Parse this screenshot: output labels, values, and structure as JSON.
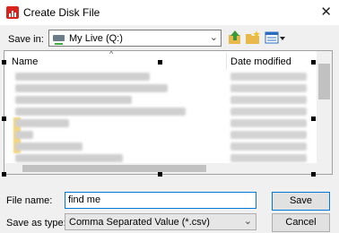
{
  "window": {
    "title": "Create Disk File"
  },
  "save_in": {
    "label": "Save in:",
    "value": "My Live (Q:)"
  },
  "columns": {
    "name": "Name",
    "date": "Date modified"
  },
  "rows": [
    {
      "name_w": 150
    },
    {
      "name_w": 170
    },
    {
      "name_w": 130
    },
    {
      "name_w": 190
    },
    {
      "name_w": 60
    },
    {
      "name_w": 20
    },
    {
      "name_w": 75
    },
    {
      "name_w": 120
    },
    {
      "name_w": 95
    }
  ],
  "file_name": {
    "label": "File name:",
    "value": "find me"
  },
  "save_as_type": {
    "label": "Save as type:",
    "value": "Comma Separated Value (*.csv)"
  },
  "buttons": {
    "save": "Save",
    "cancel": "Cancel"
  },
  "icons": {
    "app": "spreadsheet-icon",
    "close": "close-icon",
    "drive": "network-drive-icon",
    "up": "up-folder-icon",
    "new_folder": "new-folder-icon",
    "view": "view-menu-icon"
  },
  "colors": {
    "accent": "#0078d7",
    "app_icon": "#d9241b"
  }
}
